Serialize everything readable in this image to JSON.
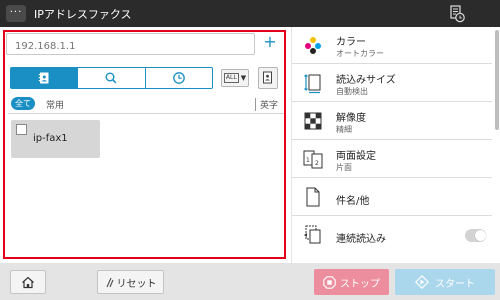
{
  "window": {
    "title": "IPアドレスファクス",
    "menu_label": "···"
  },
  "address": {
    "value": "",
    "placeholder": "192.168.1.1",
    "add_label": "+"
  },
  "search_tabs": [
    {
      "icon": "address-book-icon",
      "active": true
    },
    {
      "icon": "search-icon",
      "active": false
    },
    {
      "icon": "history-icon",
      "active": false
    }
  ],
  "filter": {
    "type_label": "ALL",
    "all_label": "全て",
    "frequent_label": "常用",
    "alpha_label": "英字"
  },
  "destinations": [
    {
      "label": "ip-fax1",
      "checked": false
    }
  ],
  "settings": {
    "color": {
      "title": "カラー",
      "value": "オートカラー"
    },
    "scan_size": {
      "title": "読込みサイズ",
      "value": "自動検出"
    },
    "resolution": {
      "title": "解像度",
      "value": "精細"
    },
    "duplex": {
      "title": "両面設定",
      "value": "片面"
    },
    "subject": {
      "title": "件名/他"
    },
    "continuous": {
      "title": "連続読込み",
      "enabled": false
    }
  },
  "footer": {
    "reset_label": "リセット",
    "stop_label": "ストップ",
    "start_label": "スタート"
  },
  "colors": {
    "accent": "#1a8fc4",
    "highlight_frame": "#e2001a",
    "stop": "#ec8e9d",
    "start": "#abd7ec"
  }
}
